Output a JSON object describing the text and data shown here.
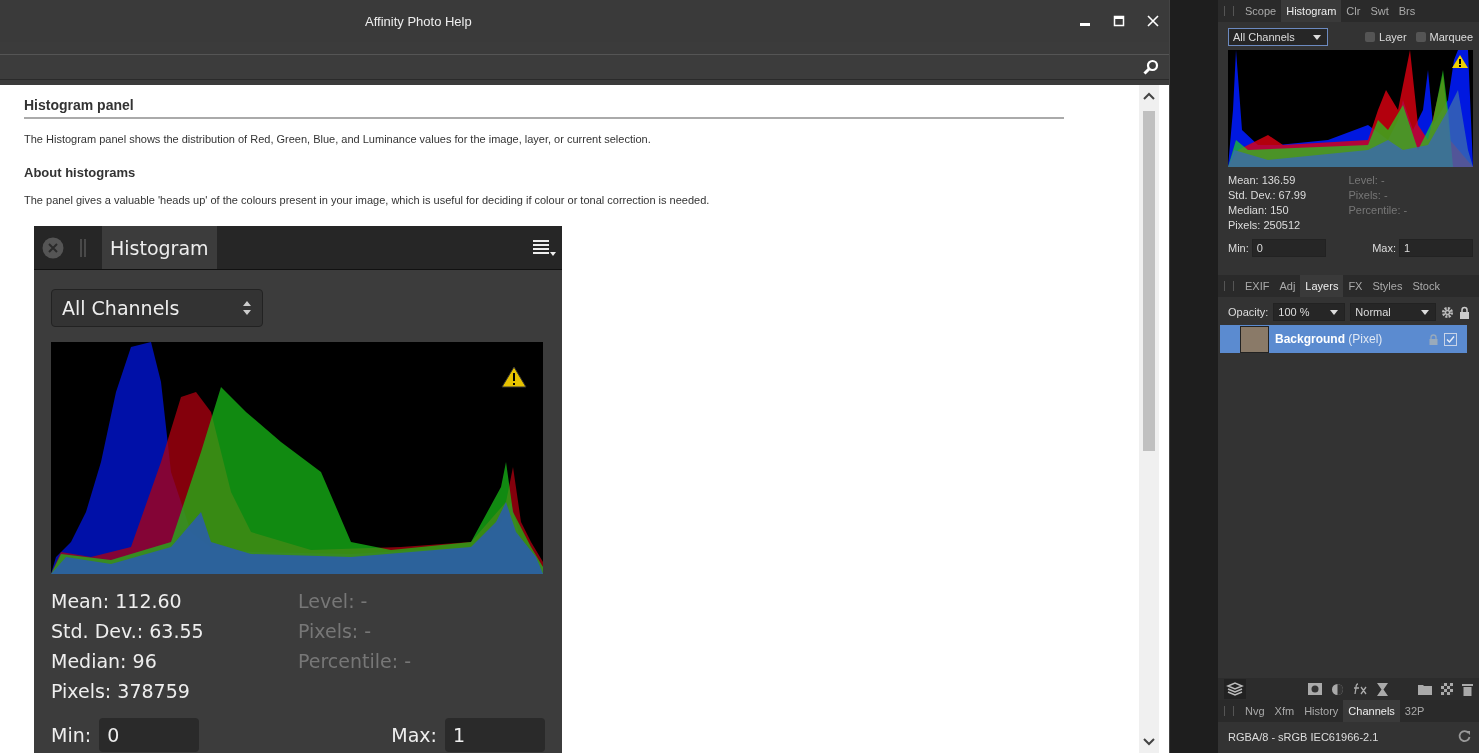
{
  "help_window": {
    "title": "Affinity Photo Help",
    "heading": "Histogram panel",
    "intro": "The Histogram panel shows the distribution of Red, Green, Blue, and Luminance values for the image, layer, or current selection.",
    "subheading": "About histograms",
    "body": "The panel gives a valuable 'heads up' of the colours present in your image, which is useful for deciding if colour or tonal correction is needed.",
    "figure": {
      "tab": "Histogram",
      "dropdown": "All Channels",
      "stats": [
        "Mean: 112.60",
        "Std. Dev.: 63.55",
        "Median: 96",
        "Pixels: 378759"
      ],
      "extra_stats": [
        "Level: -",
        "Pixels: -",
        "Percentile: -"
      ],
      "min_label": "Min:",
      "min_value": "0",
      "max_label": "Max:",
      "max_value": "1"
    }
  },
  "histogram_panel": {
    "tabs": [
      {
        "label": "Scope",
        "selected": false
      },
      {
        "label": "Histogram",
        "selected": true
      },
      {
        "label": "Clr",
        "selected": false
      },
      {
        "label": "Swt",
        "selected": false
      },
      {
        "label": "Brs",
        "selected": false
      }
    ],
    "dropdown": "All Channels",
    "checkboxes": [
      {
        "label": "Layer",
        "checked": false
      },
      {
        "label": "Marquee",
        "checked": false
      }
    ],
    "stats": [
      "Mean: 136.59",
      "Std. Dev.: 67.99",
      "Median: 150",
      "Pixels: 250512"
    ],
    "extra_stats": [
      "Level: -",
      "Pixels: -",
      "Percentile: -"
    ],
    "min_label": "Min:",
    "min_value": "0",
    "max_label": "Max:",
    "max_value": "1"
  },
  "layers_panel": {
    "tabs": [
      {
        "label": "EXIF",
        "selected": false
      },
      {
        "label": "Adj",
        "selected": false
      },
      {
        "label": "Layers",
        "selected": true
      },
      {
        "label": "FX",
        "selected": false
      },
      {
        "label": "Styles",
        "selected": false
      },
      {
        "label": "Stock",
        "selected": false
      }
    ],
    "opacity_label": "Opacity:",
    "opacity_value": "100 %",
    "blend_mode": "Normal",
    "layers": [
      {
        "name": "Background",
        "type": "(Pixel)",
        "selected": true,
        "visible": true
      }
    ]
  },
  "channels_panel": {
    "tabs": [
      {
        "label": "Nvg",
        "selected": false
      },
      {
        "label": "Xfm",
        "selected": false
      },
      {
        "label": "History",
        "selected": false
      },
      {
        "label": "Channels",
        "selected": true
      },
      {
        "label": "32P",
        "selected": false
      }
    ],
    "profile": "RGBA/8 - sRGB IEC61966-2.1"
  }
}
